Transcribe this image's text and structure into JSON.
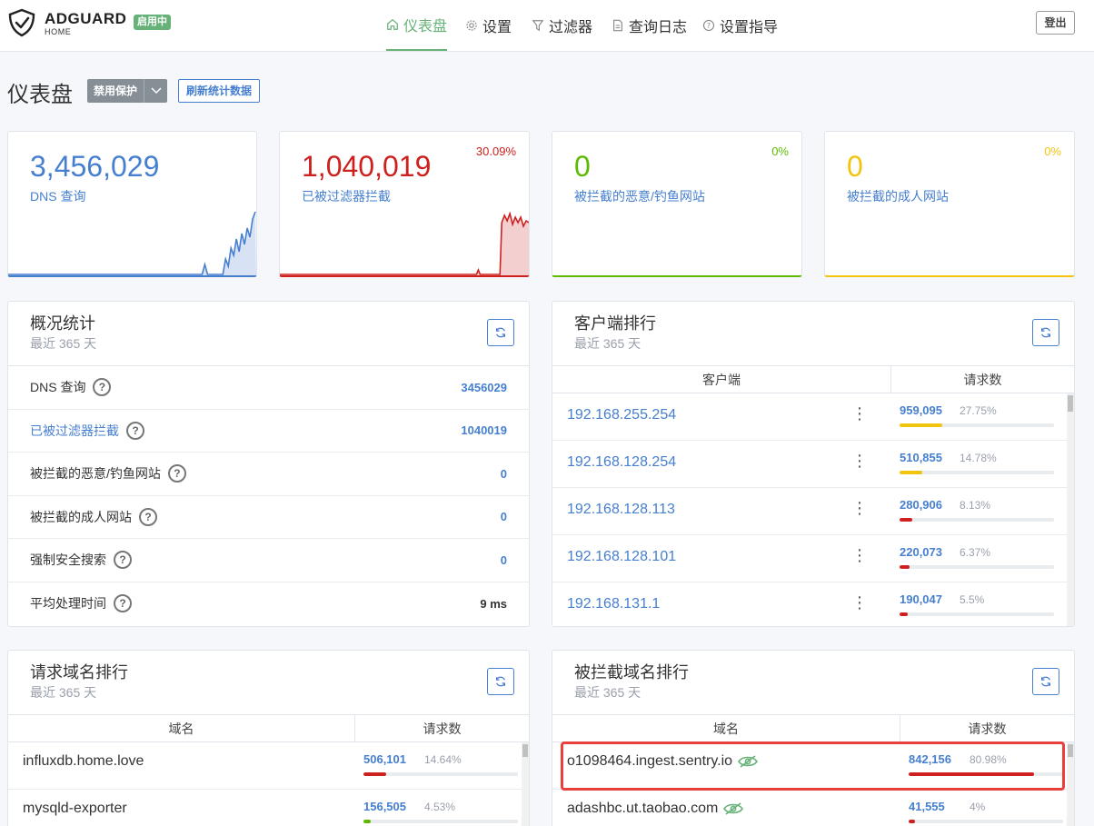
{
  "header": {
    "brand": "ADGUARD",
    "brand_sub": "HOME",
    "status_badge": "启用中",
    "nav": [
      {
        "label": "仪表盘",
        "icon": "home-icon",
        "active": true
      },
      {
        "label": "设置",
        "icon": "gear-icon",
        "active": false
      },
      {
        "label": "过滤器",
        "icon": "filter-icon",
        "active": false
      },
      {
        "label": "查询日志",
        "icon": "document-icon",
        "active": false
      },
      {
        "label": "设置指导",
        "icon": "question-circle-icon",
        "active": false
      }
    ],
    "logout": "登出"
  },
  "page": {
    "title": "仪表盘",
    "disable_btn": "禁用保护",
    "refresh_btn": "刷新统计数据"
  },
  "colors": {
    "blue": "#467fcf",
    "red": "#cd201f",
    "green": "#5eba00",
    "yellow": "#f1c40f",
    "accent": "#67b279"
  },
  "stats": [
    {
      "value": "3,456,029",
      "label": "DNS 查询",
      "pct": "",
      "color": "#467fcf"
    },
    {
      "value": "1,040,019",
      "label": "已被过滤器拦截",
      "pct": "30.09%",
      "color": "#cd201f"
    },
    {
      "value": "0",
      "label": "被拦截的恶意/钓鱼网站",
      "pct": "0%",
      "color": "#5eba00"
    },
    {
      "value": "0",
      "label": "被拦截的成人网站",
      "pct": "0%",
      "color": "#f1c40f"
    }
  ],
  "summary": {
    "title": "概况统计",
    "subtitle": "最近 365 天",
    "rows": [
      {
        "label": "DNS 查询",
        "value": "3456029",
        "link": false
      },
      {
        "label": "已被过滤器拦截",
        "value": "1040019",
        "link": true
      },
      {
        "label": "被拦截的恶意/钓鱼网站",
        "value": "0",
        "link": false
      },
      {
        "label": "被拦截的成人网站",
        "value": "0",
        "link": false
      },
      {
        "label": "强制安全搜索",
        "value": "0",
        "link": false
      },
      {
        "label": "平均处理时间",
        "value": "9 ms",
        "link": false,
        "plain": true
      }
    ]
  },
  "clients": {
    "title": "客户端排行",
    "subtitle": "最近 365 天",
    "col1": "客户端",
    "col2": "请求数",
    "rows": [
      {
        "name": "192.168.255.254",
        "count": "959,095",
        "pct": "27.75%",
        "fill": 0.2775,
        "color": "#f1c40f"
      },
      {
        "name": "192.168.128.254",
        "count": "510,855",
        "pct": "14.78%",
        "fill": 0.1478,
        "color": "#f1c40f"
      },
      {
        "name": "192.168.128.113",
        "count": "280,906",
        "pct": "8.13%",
        "fill": 0.0813,
        "color": "#cd201f"
      },
      {
        "name": "192.168.128.101",
        "count": "220,073",
        "pct": "6.37%",
        "fill": 0.0637,
        "color": "#cd201f"
      },
      {
        "name": "192.168.131.1",
        "count": "190,047",
        "pct": "5.5%",
        "fill": 0.055,
        "color": "#cd201f"
      }
    ]
  },
  "domains": {
    "title": "请求域名排行",
    "subtitle": "最近 365 天",
    "col1": "域名",
    "col2": "请求数",
    "rows": [
      {
        "name": "influxdb.home.love",
        "count": "506,101",
        "pct": "14.64%",
        "fill": 0.1464,
        "color": "#cd201f"
      },
      {
        "name": "mysqld-exporter",
        "count": "156,505",
        "pct": "4.53%",
        "fill": 0.0453,
        "color": "#5eba00"
      }
    ]
  },
  "blocked": {
    "title": "被拦截域名排行",
    "subtitle": "最近 365 天",
    "col1": "域名",
    "col2": "请求数",
    "rows": [
      {
        "name": "o1098464.ingest.sentry.io",
        "count": "842,156",
        "pct": "80.98%",
        "fill": 0.8098,
        "color": "#cd201f"
      },
      {
        "name": "adashbc.ut.taobao.com",
        "count": "41,555",
        "pct": "4%",
        "fill": 0.04,
        "color": "#cd201f"
      }
    ]
  }
}
